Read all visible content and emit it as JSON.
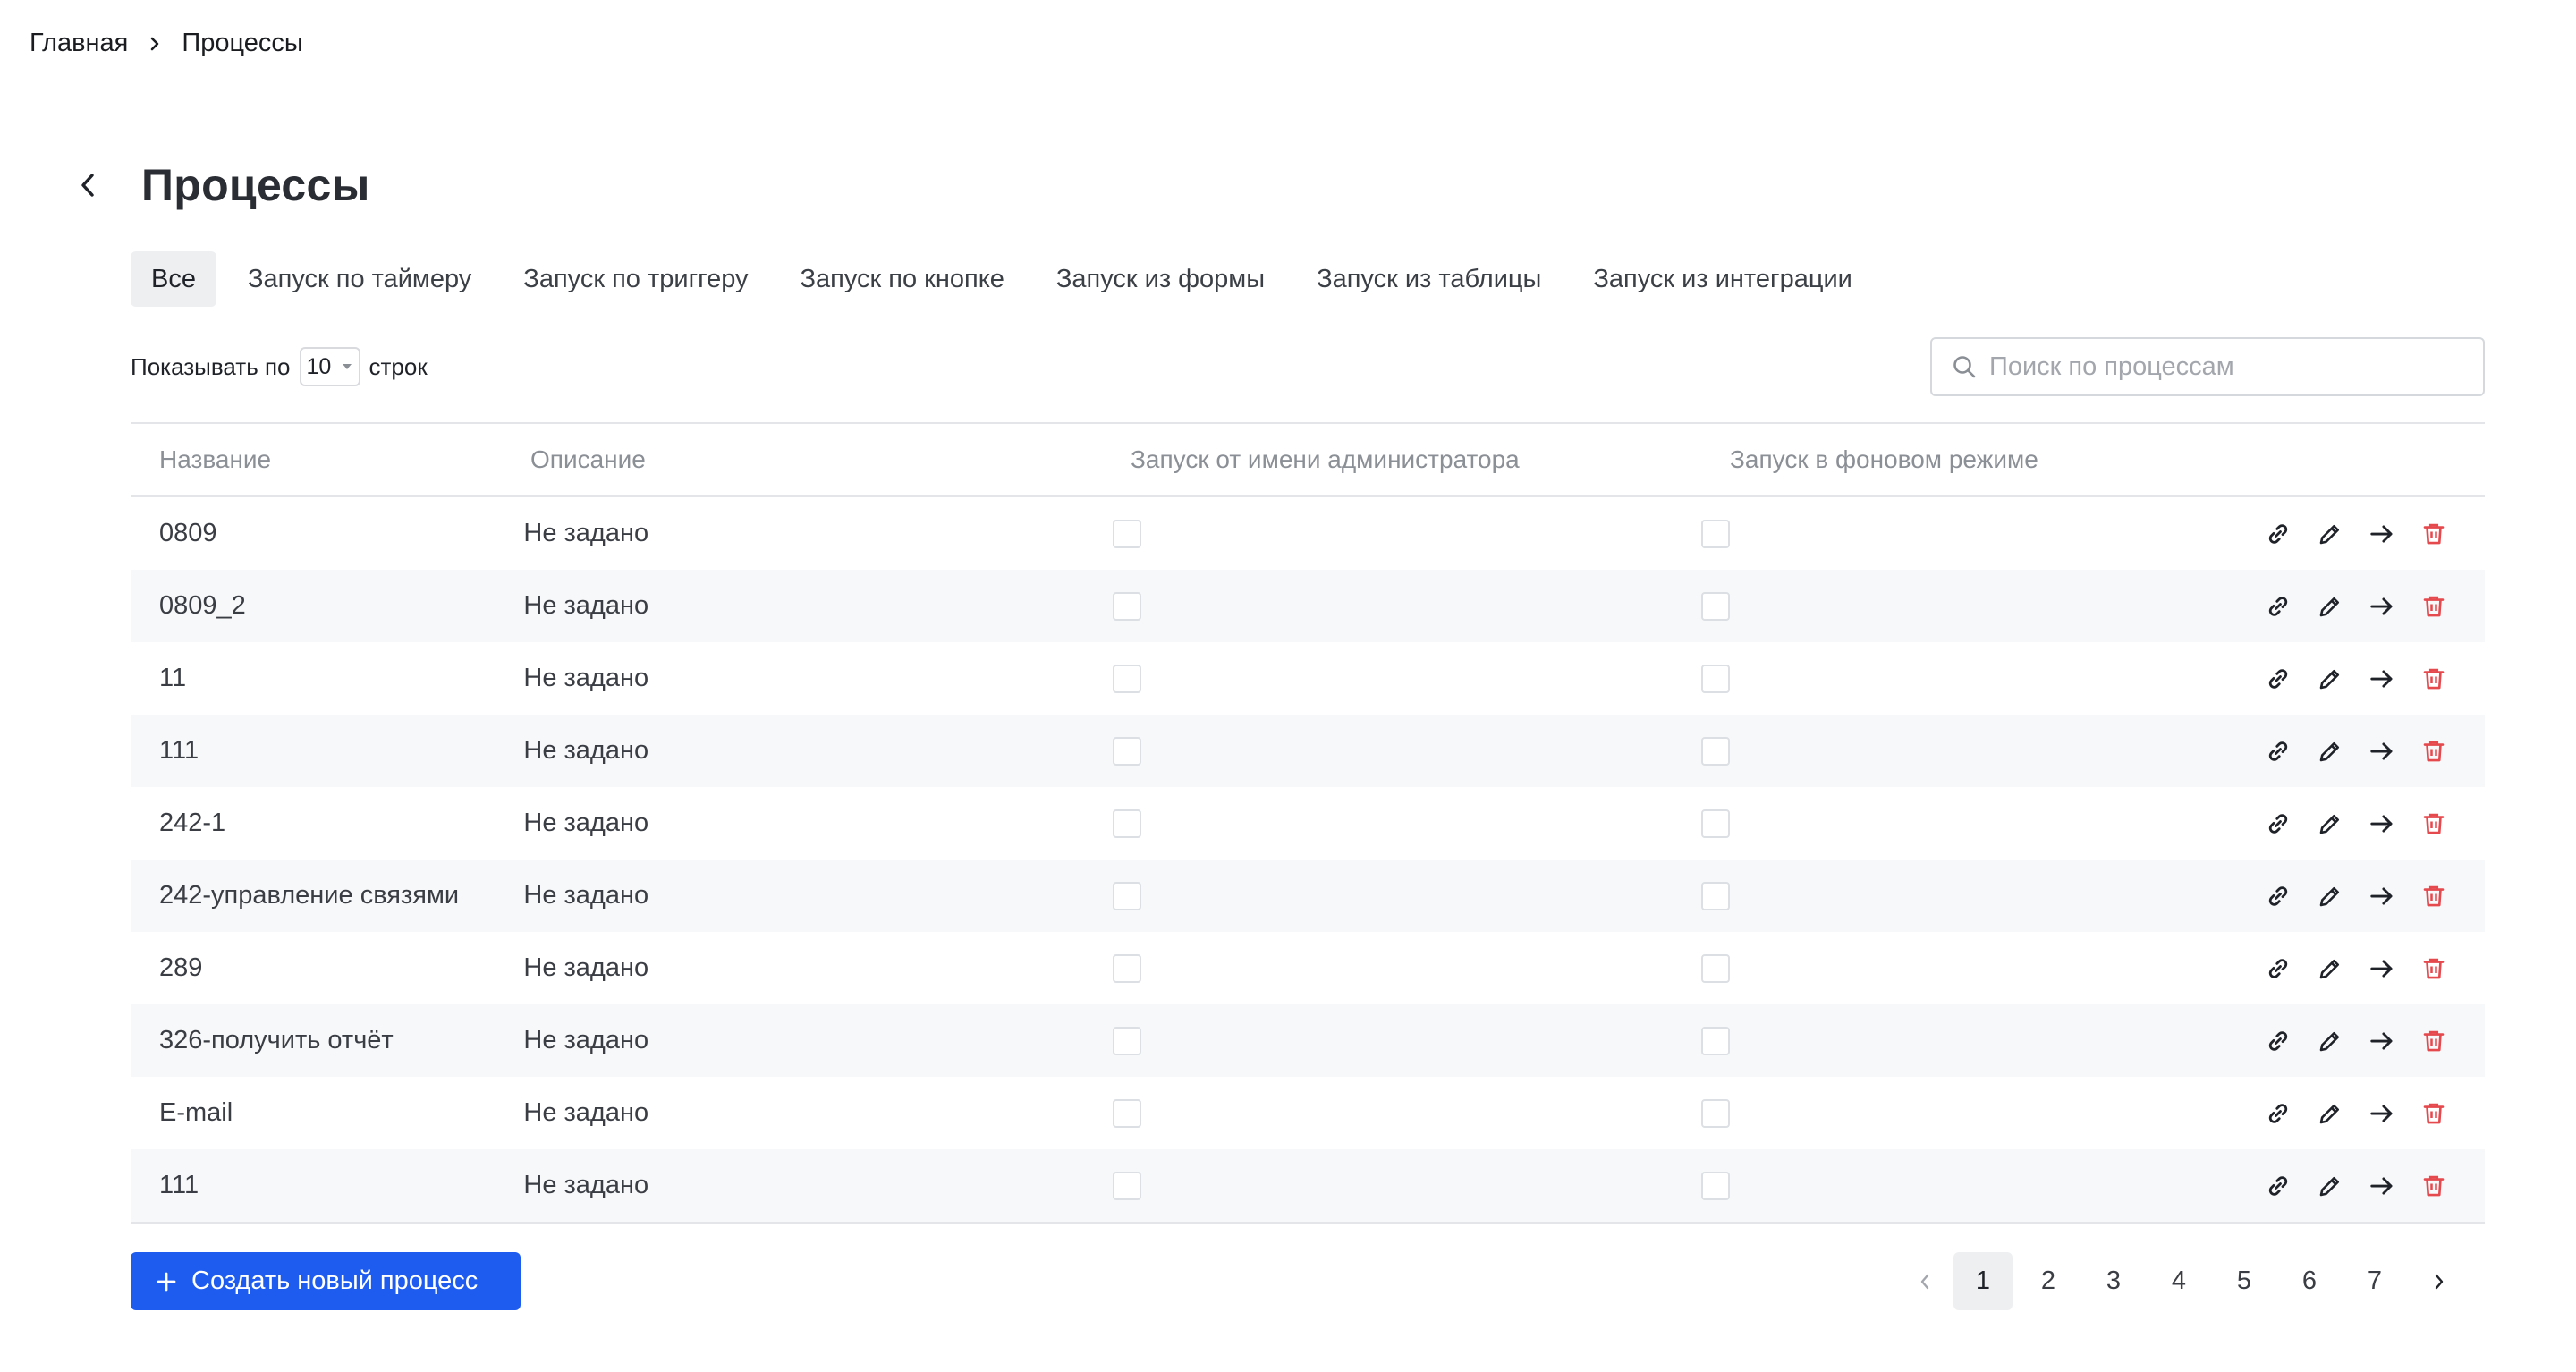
{
  "breadcrumb": {
    "home": "Главная",
    "current": "Процессы"
  },
  "header": {
    "title": "Процессы"
  },
  "tabs": [
    {
      "label": "Все",
      "active": true
    },
    {
      "label": "Запуск по таймеру",
      "active": false
    },
    {
      "label": "Запуск по триггеру",
      "active": false
    },
    {
      "label": "Запуск по кнопке",
      "active": false
    },
    {
      "label": "Запуск из формы",
      "active": false
    },
    {
      "label": "Запуск из таблицы",
      "active": false
    },
    {
      "label": "Запуск из интеграции",
      "active": false
    }
  ],
  "rows_control": {
    "prefix": "Показывать по",
    "value": "10",
    "suffix": "строк"
  },
  "search": {
    "placeholder": "Поиск по процессам",
    "value": ""
  },
  "table": {
    "columns": [
      "Название",
      "Описание",
      "Запуск от имени администратора",
      "Запуск в фоновом режиме"
    ],
    "rows": [
      {
        "name": "0809",
        "description": "Не задано",
        "admin": false,
        "background": false
      },
      {
        "name": "0809_2",
        "description": "Не задано",
        "admin": false,
        "background": false
      },
      {
        "name": "11",
        "description": "Не задано",
        "admin": false,
        "background": false
      },
      {
        "name": "111",
        "description": "Не задано",
        "admin": false,
        "background": false
      },
      {
        "name": "242-1",
        "description": "Не задано",
        "admin": false,
        "background": false
      },
      {
        "name": "242-управление связями",
        "description": "Не задано",
        "admin": false,
        "background": false
      },
      {
        "name": "289",
        "description": "Не задано",
        "admin": false,
        "background": false
      },
      {
        "name": "326-получить отчёт",
        "description": "Не задано",
        "admin": false,
        "background": false
      },
      {
        "name": "E-mail",
        "description": "Не задано",
        "admin": false,
        "background": false
      },
      {
        "name": "111",
        "description": "Не задано",
        "admin": false,
        "background": false
      }
    ],
    "row_actions": [
      "link-icon",
      "edit-icon",
      "arrow-right-icon",
      "trash-icon"
    ]
  },
  "create_button": {
    "label": "Создать новый процесс"
  },
  "pagination": {
    "pages": [
      "1",
      "2",
      "3",
      "4",
      "5",
      "6",
      "7"
    ],
    "current": "1"
  },
  "colors": {
    "accent": "#1e5cf0",
    "danger": "#e5484d",
    "active_tab_bg": "#eeeff1"
  }
}
